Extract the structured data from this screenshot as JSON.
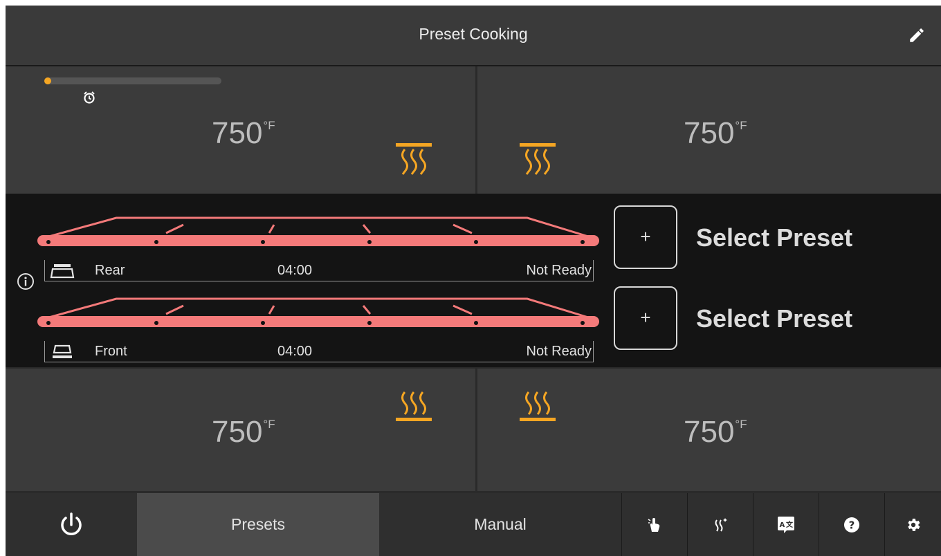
{
  "header": {
    "title": "Preset Cooking",
    "edit_icon": "pencil-icon"
  },
  "zones": {
    "top_left": {
      "temp": "750",
      "unit": "°F",
      "heater": "top-heater-icon"
    },
    "top_right": {
      "temp": "750",
      "unit": "°F",
      "heater": "top-heater-icon"
    },
    "bottom_left": {
      "temp": "750",
      "unit": "°F",
      "heater": "bottom-heater-icon"
    },
    "bottom_right": {
      "temp": "750",
      "unit": "°F",
      "heater": "bottom-heater-icon"
    }
  },
  "progress": {
    "fraction": 0.04,
    "color": "#f5a623"
  },
  "belts": [
    {
      "name": "Rear",
      "time": "04:00",
      "status": "Not Ready",
      "icon": "rear-belt-icon"
    },
    {
      "name": "Front",
      "time": "04:00",
      "status": "Not Ready",
      "icon": "front-belt-icon"
    }
  ],
  "presets": [
    {
      "plus": "+",
      "label": "Select Preset"
    },
    {
      "plus": "+",
      "label": "Select Preset"
    }
  ],
  "footer": {
    "presets_label": "Presets",
    "manual_label": "Manual"
  },
  "colors": {
    "accent": "#f5a623",
    "belt": "#f47a7a",
    "panel": "#3b3b3b",
    "middle_bg": "#141414"
  }
}
